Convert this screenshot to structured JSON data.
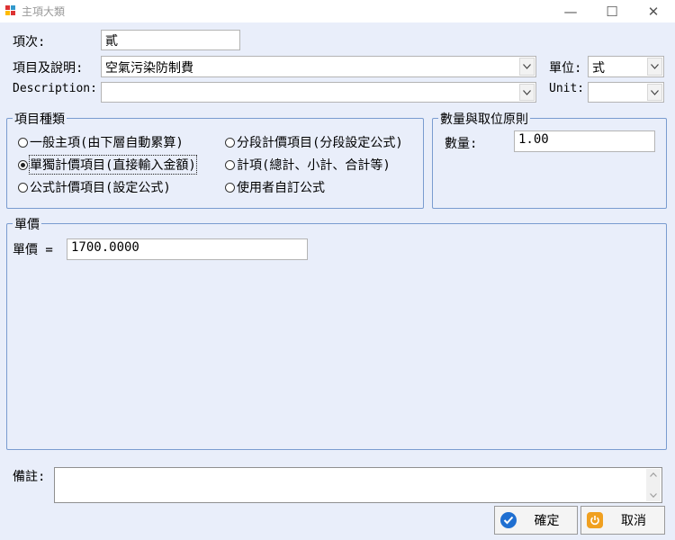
{
  "window": {
    "title": "主項大類",
    "minimize_glyph": "—",
    "maximize_glyph": "☐",
    "close_glyph": "✕",
    "app_icon": "app-window-icon"
  },
  "form": {
    "item_no_label": "項次:",
    "item_no_value": "貳",
    "item_desc_label": "項目及說明:",
    "item_desc_value": "空氣污染防制費",
    "unit_label": "單位:",
    "unit_value": "式",
    "description_label": "Description:",
    "description_value": "",
    "unit_en_label": "Unit:",
    "unit_en_value": ""
  },
  "item_type": {
    "legend": "項目種類",
    "options": [
      {
        "label": "一般主項(由下層自動累算)",
        "selected": false
      },
      {
        "label": "分段計價項目(分段設定公式)",
        "selected": false
      },
      {
        "label": "單獨計價項目(直接輸入金額)",
        "selected": true
      },
      {
        "label": "計項(總計、小計、合計等)",
        "selected": false
      },
      {
        "label": "公式計價項目(設定公式)",
        "selected": false
      },
      {
        "label": "使用者自訂公式",
        "selected": false
      }
    ]
  },
  "quantity": {
    "legend": "數量與取位原則",
    "label": "數量:",
    "value": "1.00"
  },
  "unit_price": {
    "legend": "單價",
    "label": "單價 =",
    "value": "1700.0000"
  },
  "remark": {
    "label": "備註:",
    "value": ""
  },
  "buttons": {
    "ok_label": "確定",
    "cancel_label": "取消",
    "ok_icon": "check-circle-icon",
    "cancel_icon": "power-icon"
  },
  "colors": {
    "background": "#e9eefa",
    "group_border": "#7a9cd0",
    "ok_icon": "#1f6fd1",
    "cancel_icon": "#f0a020"
  }
}
